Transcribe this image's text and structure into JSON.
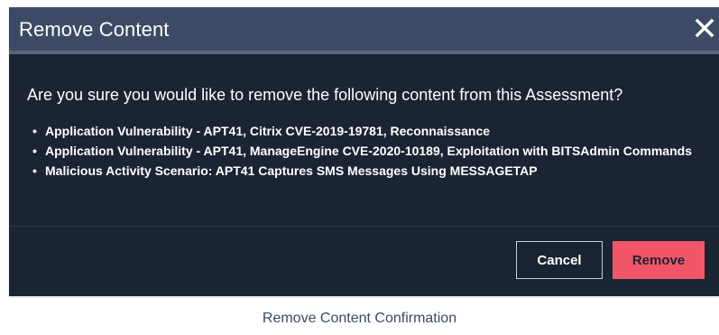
{
  "dialog": {
    "title": "Remove Content",
    "close_icon": "close-icon",
    "question": "Are you sure you would like to remove the following content from this Assessment?",
    "bullet": "•",
    "items": [
      {
        "label": "Application Vulnerability - APT41, Citrix CVE-2019-19781, Reconnaissance"
      },
      {
        "label": "Application Vulnerability - APT41, ManageEngine CVE-2020-10189, Exploitation with BITSAdmin Commands"
      },
      {
        "label": "Malicious Activity Scenario: APT41 Captures SMS Messages Using MESSAGETAP"
      }
    ],
    "cancel_label": "Cancel",
    "remove_label": "Remove"
  },
  "caption": "Remove Content Confirmation",
  "colors": {
    "dialog_background": "#1b2433",
    "header_background": "#3c4b63",
    "remove_button": "#f25668",
    "caption_text": "#3b4a63"
  }
}
